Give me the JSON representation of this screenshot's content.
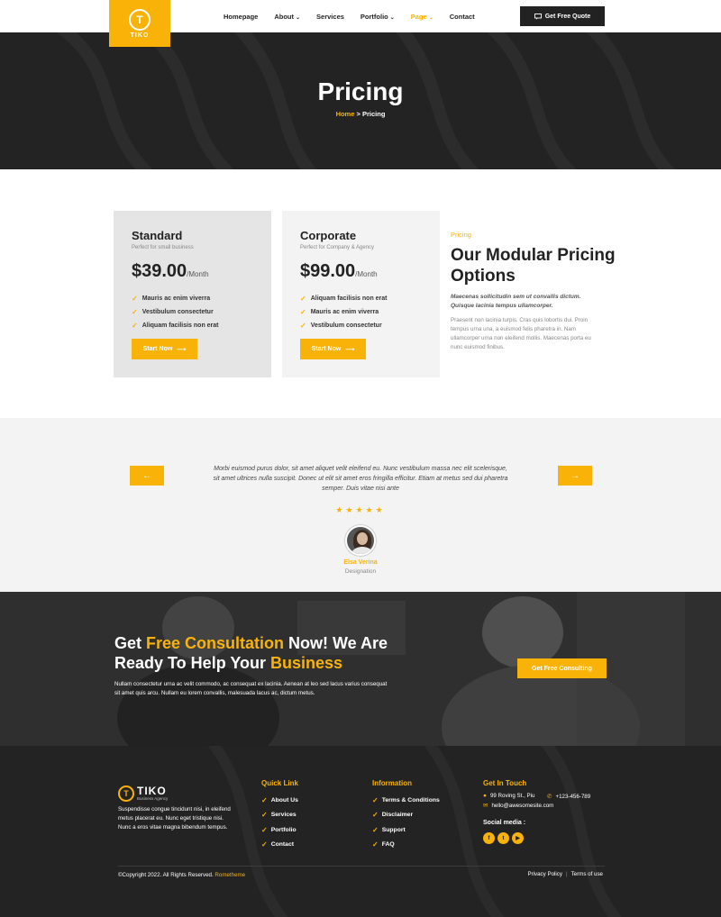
{
  "brand": {
    "logo_text": "TIKO",
    "logo_letter": "T"
  },
  "nav": {
    "items": [
      {
        "label": "Homepage",
        "caret": ""
      },
      {
        "label": "About",
        "caret": "⌄"
      },
      {
        "label": "Services",
        "caret": ""
      },
      {
        "label": "Portfolio",
        "caret": "⌄"
      },
      {
        "label": "Page",
        "caret": "⌄",
        "active": true
      },
      {
        "label": "Contact",
        "caret": ""
      }
    ],
    "quote_button": "Get Free Quote"
  },
  "hero": {
    "title": "Pricing",
    "breadcrumb_home": "Home",
    "breadcrumb_sep": ">",
    "breadcrumb_current": "Pricing"
  },
  "pricing": {
    "cards": [
      {
        "name": "Standard",
        "subtitle": "Perfect for small business",
        "price": "$39.00",
        "period": "/Month",
        "features": [
          "Mauris ac enim viverra",
          "Vestibulum consectetur",
          "Aliquam facilisis non erat"
        ],
        "button": "Start Now"
      },
      {
        "name": "Corporate",
        "subtitle": "Perfect for Company & Agency",
        "price": "$99.00",
        "period": "/Month",
        "features": [
          "Aliquam facilisis non erat",
          "Mauris ac enim viverra",
          "Vestibulum consectetur"
        ],
        "button": "Start Now"
      }
    ],
    "label": "Pricing",
    "title": "Our Modular Pricing Options",
    "italic_text": "Maecenas sollicitudin sem ut convallis dictum. Quisque lacinia tempus ullamcorper.",
    "body_text": "Praesent non lacinia turpis. Cras quis lobortis dui. Proin tempus urna una, a euismod felis pharetra in. Nam ullamcorper urna non eleifend mollis. Maecenas porta eu nunc euismod finibus."
  },
  "testimonial": {
    "quote": "Morbi euismod purus dolor, sit amet aliquet velit eleifend eu. Nunc vestibulum massa nec elit scelerisque, sit amet ultrices nulla suscipit. Donec ut elit sit amet eros fringilla efficitur. Etiam at metus sed dui pharetra semper. Duis vitae nisi ante",
    "stars": "★★★★★",
    "rating": 5,
    "name": "Elsa Verina",
    "role": "Designation",
    "prev_arrow": "←",
    "next_arrow": "→"
  },
  "cta": {
    "title_part1": "Get ",
    "title_highlight1": "Free Consultation",
    "title_part2": " Now! We Are Ready To Help Your ",
    "title_highlight2": "Business",
    "text": "Nullam consectetur urna ac velit commodo, ac consequat ex lacinia. Aenean at leo sed lacus varius consequat sit amet quis arcu. Nullam eu lorem convallis, malesuada lacus ac, dictum metus.",
    "button": "Get Free Consulting"
  },
  "footer": {
    "logo_name": "TIKO",
    "logo_sub": "Business Agency",
    "about": "Suspendisse congue tincidunt nisi, in eleifend metus placerat eu. Nunc eget tristique nisi. Nunc a eros vitae magna bibendum tempus.",
    "quick_link_heading": "Quick Link",
    "quick_links": [
      "About Us",
      "Services",
      "Portfolio",
      "Contact"
    ],
    "info_heading": "Information",
    "info_links": [
      "Terms & Conditions",
      "Disclaimer",
      "Support",
      "FAQ"
    ],
    "touch_heading": "Get In Touch",
    "address": "99 Roving St., Piu",
    "phone": "+123-456-789",
    "email": "hello@awesomesite.com",
    "social_heading": "Social media :",
    "copyright_text": "©Copyright 2022. All Rights Reserved.",
    "copyright_brand": "Rometheme",
    "privacy": "Privacy Policy",
    "separator": "|",
    "terms": "Terms of use"
  },
  "colors": {
    "accent": "#f9b208",
    "dark": "#232323",
    "light_bg": "#f3f3f3"
  }
}
